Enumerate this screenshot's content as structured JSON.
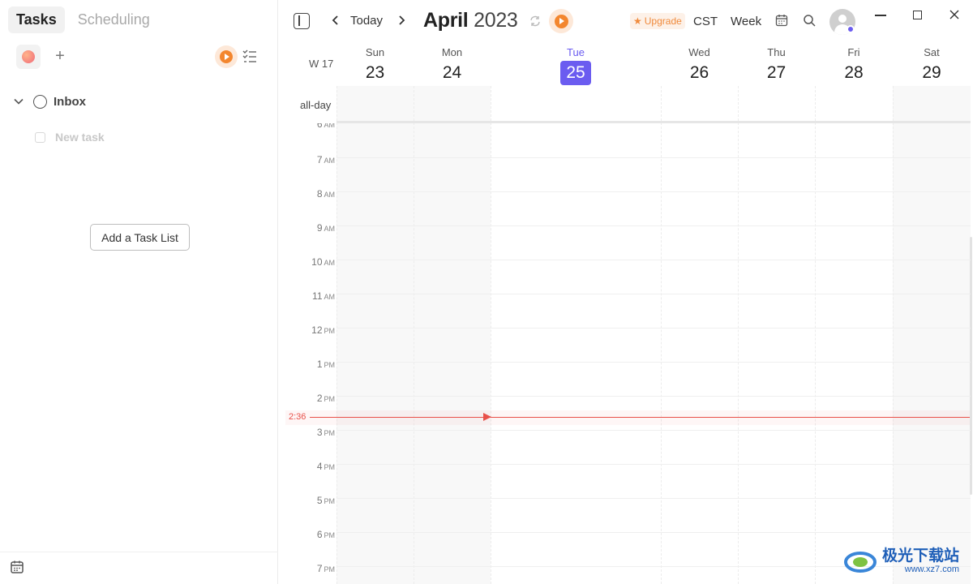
{
  "left_panel": {
    "tabs": [
      {
        "label": "Tasks",
        "active": true
      },
      {
        "label": "Scheduling",
        "active": false
      }
    ],
    "lists": [
      {
        "label": "Inbox",
        "expanded": true
      }
    ],
    "new_task_placeholder": "New task",
    "add_list_label": "Add a Task List"
  },
  "toolbar": {
    "today_label": "Today",
    "month": "April",
    "year": "2023",
    "upgrade_label": "Upgrade",
    "timezone": "CST",
    "view": "Week"
  },
  "week": {
    "number": "W 17",
    "days": [
      {
        "name": "Sun",
        "num": "23",
        "today": false,
        "shaded": true
      },
      {
        "name": "Mon",
        "num": "24",
        "today": false,
        "shaded": true
      },
      {
        "name": "Tue",
        "num": "25",
        "today": true,
        "shaded": false
      },
      {
        "name": "Wed",
        "num": "26",
        "today": false,
        "shaded": false
      },
      {
        "name": "Thu",
        "num": "27",
        "today": false,
        "shaded": false
      },
      {
        "name": "Fri",
        "num": "28",
        "today": false,
        "shaded": false
      },
      {
        "name": "Sat",
        "num": "29",
        "today": false,
        "shaded": true
      }
    ],
    "allday_label": "all-day",
    "hours": [
      {
        "h": "6",
        "p": "AM"
      },
      {
        "h": "7",
        "p": "AM"
      },
      {
        "h": "8",
        "p": "AM"
      },
      {
        "h": "9",
        "p": "AM"
      },
      {
        "h": "10",
        "p": "AM"
      },
      {
        "h": "11",
        "p": "AM"
      },
      {
        "h": "12",
        "p": "PM"
      },
      {
        "h": "1",
        "p": "PM"
      },
      {
        "h": "2",
        "p": "PM"
      },
      {
        "h": "3",
        "p": "PM"
      },
      {
        "h": "4",
        "p": "PM"
      },
      {
        "h": "5",
        "p": "PM"
      },
      {
        "h": "6",
        "p": "PM"
      },
      {
        "h": "7",
        "p": "PM"
      }
    ],
    "now_label": "2:36"
  },
  "watermark": {
    "name": "极光下载站",
    "url": "www.xz7.com"
  },
  "colors": {
    "accent": "#6b5cf0",
    "now": "#e8514a",
    "focus": "#f3862e"
  }
}
